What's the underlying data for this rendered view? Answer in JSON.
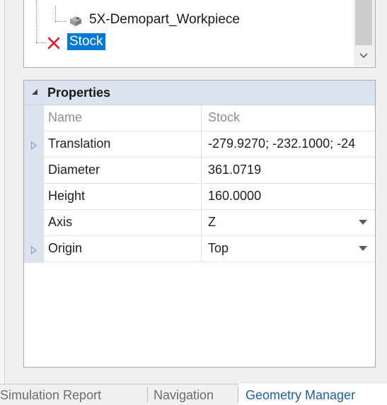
{
  "tree": {
    "items": [
      {
        "label": "5X-Demopart_Workpiece",
        "icon": "workpiece-solid-icon"
      },
      {
        "label": "Stock",
        "icon": "red-x-icon",
        "selected": true
      }
    ]
  },
  "properties": {
    "section_label": "Properties",
    "rows": [
      {
        "name": "Name",
        "value": "Stock",
        "disabled": true
      },
      {
        "name": "Translation",
        "value": "-279.9270; -232.1000; -24",
        "expandable": true
      },
      {
        "name": "Diameter",
        "value": "361.0719"
      },
      {
        "name": "Height",
        "value": "160.0000"
      },
      {
        "name": "Axis",
        "value": "Z",
        "dropdown": true
      },
      {
        "name": "Origin",
        "value": "Top",
        "dropdown": true,
        "expandable": true
      }
    ]
  },
  "tabs": [
    {
      "label": "Simulation Report",
      "active": false
    },
    {
      "label": "Navigation",
      "active": false
    },
    {
      "label": "Geometry Manager",
      "active": true
    }
  ],
  "colors": {
    "selection": "#0078d7",
    "header": "#dbe3ef",
    "active_tab": "#1f5fa8",
    "error_x": "#e81123"
  }
}
